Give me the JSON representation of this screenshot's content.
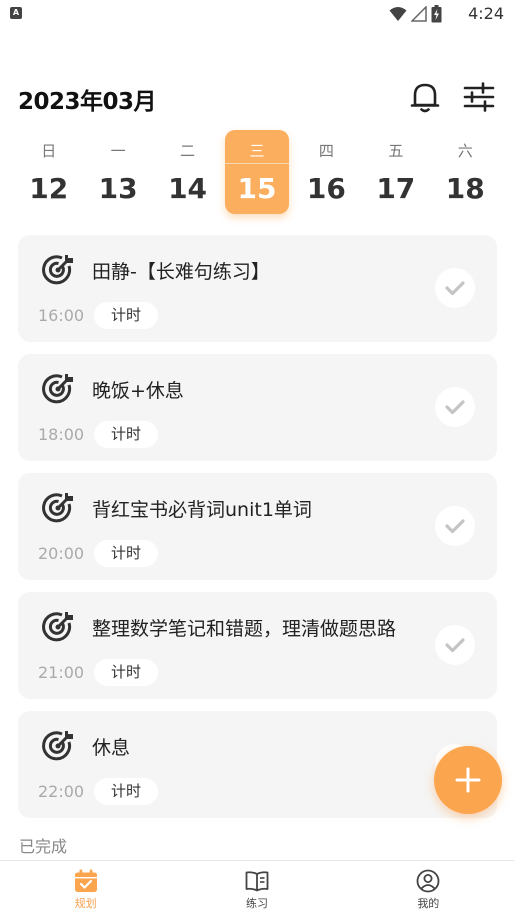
{
  "status_bar": {
    "app_badge": "A",
    "time": "4:24"
  },
  "header": {
    "month": "2023年03月",
    "bell_icon": "bell-icon",
    "filter_icon": "sliders-icon"
  },
  "week": [
    {
      "dow": "日",
      "day": "12",
      "selected": false
    },
    {
      "dow": "一",
      "day": "13",
      "selected": false
    },
    {
      "dow": "二",
      "day": "14",
      "selected": false
    },
    {
      "dow": "三",
      "day": "15",
      "selected": true
    },
    {
      "dow": "四",
      "day": "16",
      "selected": false
    },
    {
      "dow": "五",
      "day": "17",
      "selected": false
    },
    {
      "dow": "六",
      "day": "18",
      "selected": false
    }
  ],
  "tasks": [
    {
      "title": "田静-【长难句练习】",
      "time": "16:00",
      "timer_label": "计时"
    },
    {
      "title": "晚饭+休息",
      "time": "18:00",
      "timer_label": "计时"
    },
    {
      "title": "背红宝书必背词unit1单词",
      "time": "20:00",
      "timer_label": "计时"
    },
    {
      "title": "整理数学笔记和错题，理清做题思路",
      "time": "21:00",
      "timer_label": "计时"
    },
    {
      "title": "休息",
      "time": "22:00",
      "timer_label": "计时"
    }
  ],
  "completed_label": "已完成",
  "nav": [
    {
      "label": "规划",
      "icon": "calendar-check-icon",
      "active": true
    },
    {
      "label": "练习",
      "icon": "book-icon",
      "active": false
    },
    {
      "label": "我的",
      "icon": "user-icon",
      "active": false
    }
  ],
  "colors": {
    "accent": "#fba54f",
    "card_bg": "#f5f5f5"
  }
}
